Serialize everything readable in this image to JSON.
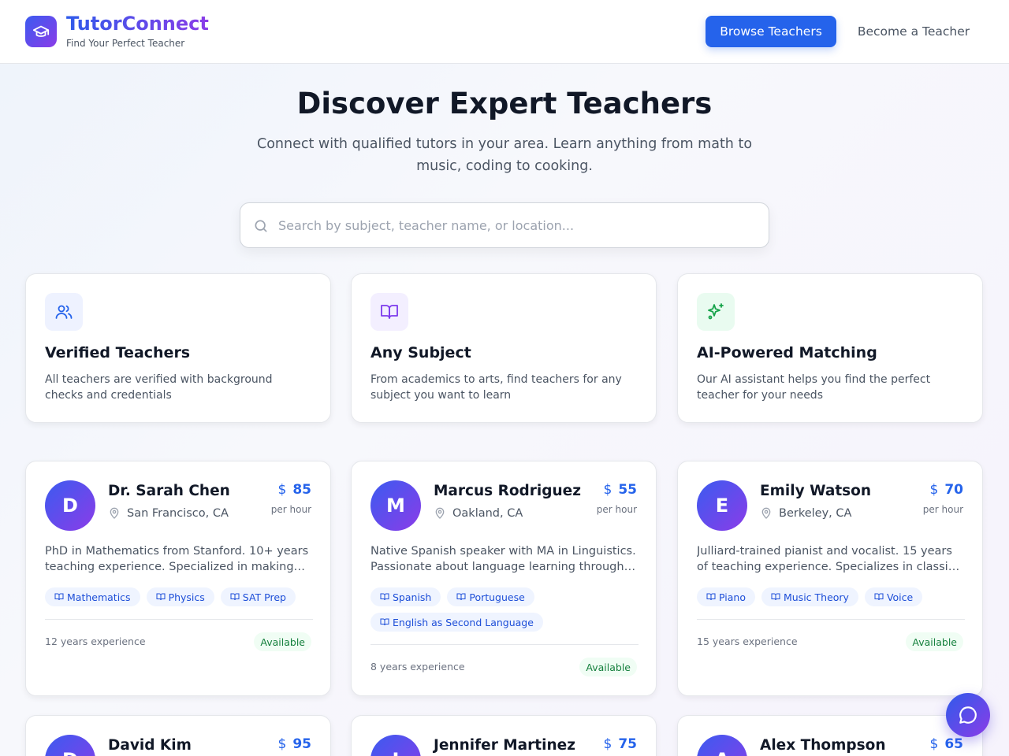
{
  "header": {
    "brand_name": "TutorConnect",
    "tagline": "Find Your Perfect Teacher",
    "browse_label": "Browse Teachers",
    "become_label": "Become a Teacher",
    "logo_icon": "graduation-cap-icon"
  },
  "hero": {
    "title": "Discover Expert Teachers",
    "subtitle": "Connect with qualified tutors in your area. Learn anything from math to music, coding to cooking.",
    "search_placeholder": "Search by subject, teacher name, or location...",
    "search_value": ""
  },
  "features": [
    {
      "title": "Verified Teachers",
      "desc": "All teachers are verified with background checks and credentials",
      "icon": "users-icon",
      "color": "#eef2ff"
    },
    {
      "title": "Any Subject",
      "desc": "From academics to arts, find teachers for any subject you want to learn",
      "icon": "book-open-icon",
      "color": "#f3efff"
    },
    {
      "title": "AI-Powered Matching",
      "desc": "Our AI assistant helps you find the perfect teacher for your needs",
      "icon": "sparkles-icon",
      "color": "#e9fbf0"
    }
  ],
  "teachers": [
    {
      "initial": "D",
      "name": "Dr. Sarah Chen",
      "location": "San Francisco, CA",
      "currency": "$",
      "price": "85",
      "per": "per hour",
      "bio": "PhD in Mathematics from Stanford. 10+ years teaching experience. Specialized in making complex concepts simple.",
      "subjects": [
        "Mathematics",
        "Physics",
        "SAT Prep"
      ],
      "experience": "12 years experience",
      "status": "Available"
    },
    {
      "initial": "M",
      "name": "Marcus Rodriguez",
      "location": "Oakland, CA",
      "currency": "$",
      "price": "55",
      "per": "per hour",
      "bio": "Native Spanish speaker with MA in Linguistics. Passionate about language learning through conversation.",
      "subjects": [
        "Spanish",
        "Portuguese",
        "English as Second Language"
      ],
      "experience": "8 years experience",
      "status": "Available"
    },
    {
      "initial": "E",
      "name": "Emily Watson",
      "location": "Berkeley, CA",
      "currency": "$",
      "price": "70",
      "per": "per hour",
      "bio": "Julliard-trained pianist and vocalist. 15 years of teaching experience. Specializes in classical and jazz.",
      "subjects": [
        "Piano",
        "Music Theory",
        "Voice"
      ],
      "experience": "15 years experience",
      "status": "Available"
    },
    {
      "initial": "D",
      "name": "David Kim",
      "currency": "$",
      "price": "95"
    },
    {
      "initial": "J",
      "name": "Jennifer Martinez",
      "currency": "$",
      "price": "75"
    },
    {
      "initial": "A",
      "name": "Alex Thompson",
      "currency": "$",
      "price": "65"
    }
  ],
  "chat": {
    "icon": "chat-bubble-icon"
  },
  "colors": {
    "primary": "#2563eb",
    "accent": "#8b3ce8",
    "available": "#15803d"
  }
}
